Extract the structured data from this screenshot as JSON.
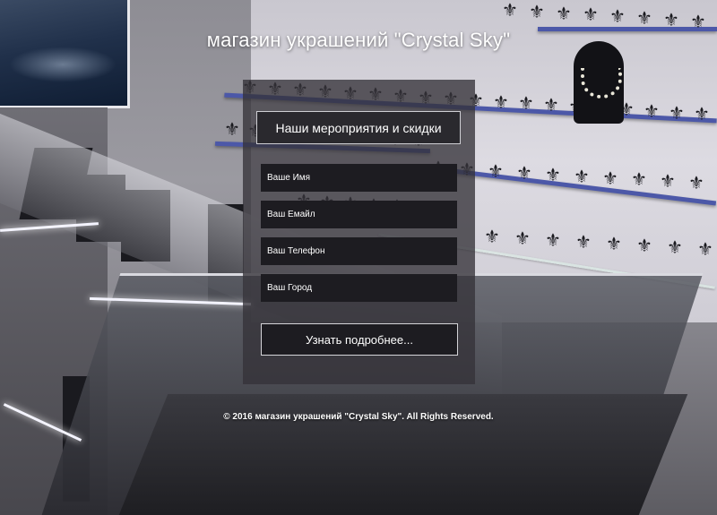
{
  "header": {
    "title": "магазин украшений \"Crystal Sky\""
  },
  "form": {
    "events_button_label": "Наши мероприятия и скидки",
    "name_placeholder": "Ваше Имя",
    "email_placeholder": "Ваш Емайл",
    "phone_placeholder": "Ваш Телефон",
    "city_placeholder": "Ваш Город",
    "submit_label": "Узнать подробнее..."
  },
  "footer": {
    "copyright": "© 2016 магазин украшений \"Crystal Sky\". All Rights Reserved."
  },
  "colors": {
    "panel": "#343238",
    "field": "#1d1c21",
    "text": "#ffffff",
    "shelf_accent": "#4c58a8"
  }
}
